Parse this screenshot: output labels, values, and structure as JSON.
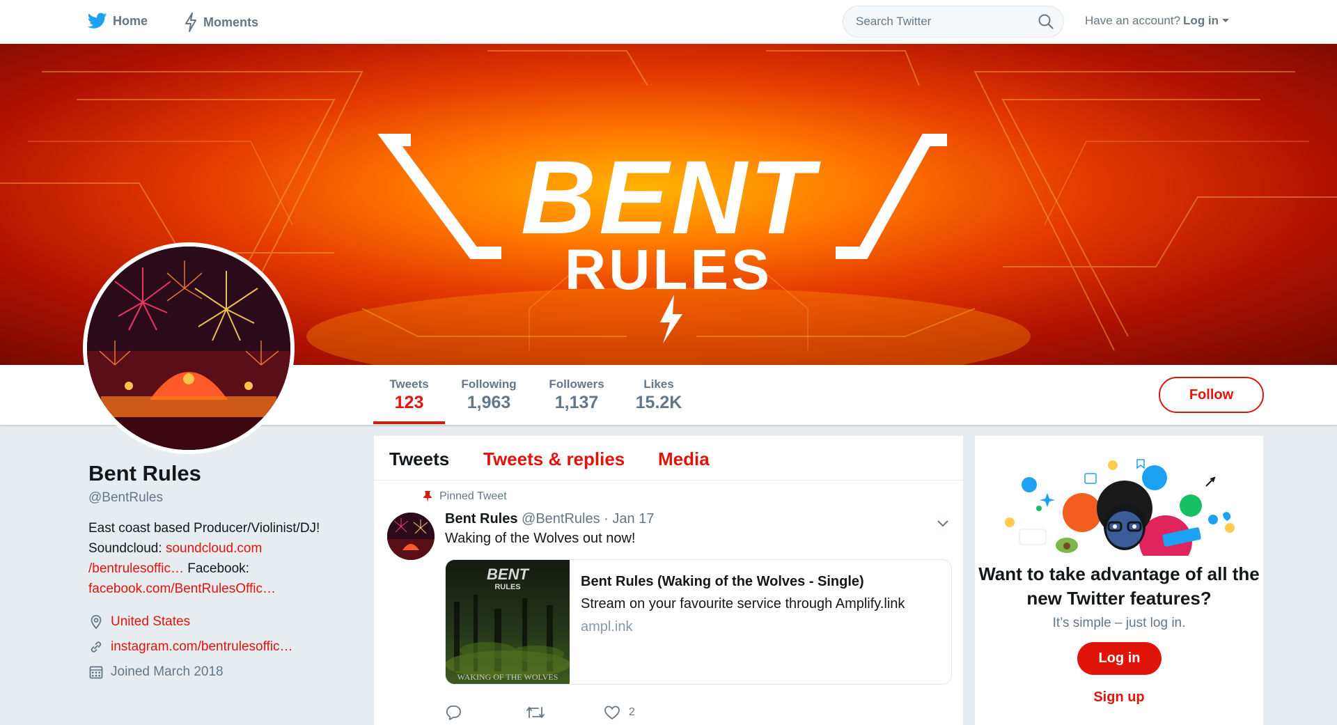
{
  "nav": {
    "home_label": "Home",
    "moments_label": "Moments",
    "search_placeholder": "Search Twitter",
    "have_account_text": "Have an account?",
    "login_label": "Log in"
  },
  "banner": {
    "logo_line1": "BENT",
    "logo_line2": "RULES"
  },
  "stats": [
    {
      "label": "Tweets",
      "value": "123"
    },
    {
      "label": "Following",
      "value": "1,963"
    },
    {
      "label": "Followers",
      "value": "1,137"
    },
    {
      "label": "Likes",
      "value": "15.2K"
    }
  ],
  "follow_label": "Follow",
  "profile": {
    "name": "Bent Rules",
    "handle": "@BentRules",
    "bio_line1": "East coast based Producer/Violinist/DJ!",
    "bio_soundcloud_label": "Soundcloud:",
    "bio_soundcloud_link1": "soundcloud.com",
    "bio_soundcloud_link2": "/bentrulesoffic…",
    "bio_facebook_label": "Facebook:",
    "bio_facebook_link": "facebook.com/BentRulesOffic…",
    "location": "United States",
    "website": "instagram.com/bentrulesoffic…",
    "joined": "Joined March 2018"
  },
  "timeline": {
    "tabs": [
      "Tweets",
      "Tweets & replies",
      "Media"
    ],
    "pinned_label": "Pinned Tweet",
    "tweet": {
      "name": "Bent Rules",
      "handle": "@BentRules",
      "separator": "·",
      "date": "Jan 17",
      "text": "Waking of the Wolves out now!",
      "card_title": "Bent Rules (Waking of the Wolves - Single)",
      "card_description": "Stream on your favourite service through Amplify.link",
      "card_domain": "ampl.ink",
      "card_image_caption": "WAKING OF THE WOLVES",
      "like_count": "2"
    }
  },
  "promo": {
    "title": "Want to take advantage of all the new Twitter features?",
    "subtitle": "It’s simple – just log in.",
    "login_label": "Log in",
    "signup_label": "Sign up"
  },
  "colors": {
    "accent": "#e0140a",
    "twitter_blue": "#1da1f2",
    "muted": "#657786",
    "background": "#e6ecf0"
  },
  "icons": [
    "twitter-bird-icon",
    "lightning-icon",
    "search-icon",
    "caret-down-icon",
    "location-pin-icon",
    "link-icon",
    "calendar-icon",
    "pin-icon",
    "chevron-down-icon",
    "reply-icon",
    "retweet-icon",
    "heart-icon"
  ]
}
